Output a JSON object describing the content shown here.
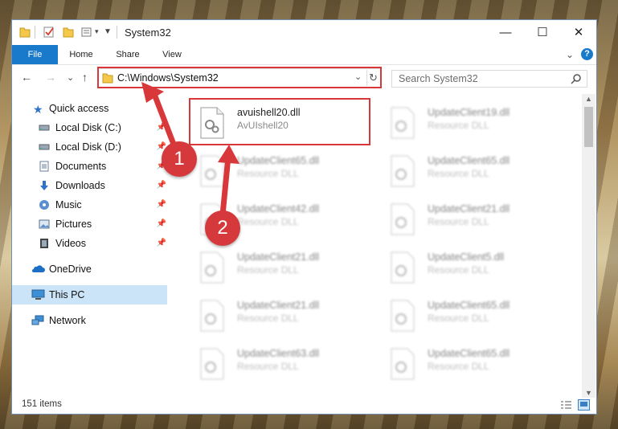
{
  "window": {
    "title": "System32",
    "controls": {
      "minimize": "—",
      "maximize": "☐",
      "close": "✕"
    }
  },
  "ribbon": {
    "tabs": [
      {
        "label": "File"
      },
      {
        "label": "Home"
      },
      {
        "label": "Share"
      },
      {
        "label": "View"
      }
    ],
    "help": "?",
    "expand": "⌄"
  },
  "navigation": {
    "back": "←",
    "forward": "→",
    "recent": "⌄",
    "up": "↑",
    "address": "C:\\Windows\\System32",
    "refresh": "↻",
    "search_placeholder": "Search System32"
  },
  "sidebar": {
    "items": [
      {
        "label": "Quick access",
        "icon": "star-icon"
      },
      {
        "label": "Local Disk (C:)",
        "icon": "drive-icon",
        "pinned": true
      },
      {
        "label": "Local Disk (D:)",
        "icon": "drive-icon",
        "pinned": true
      },
      {
        "label": "Documents",
        "icon": "documents-icon",
        "pinned": true
      },
      {
        "label": "Downloads",
        "icon": "downloads-icon",
        "pinned": true
      },
      {
        "label": "Music",
        "icon": "music-icon",
        "pinned": true
      },
      {
        "label": "Pictures",
        "icon": "pictures-icon",
        "pinned": true
      },
      {
        "label": "Videos",
        "icon": "videos-icon",
        "pinned": true
      },
      {
        "label": "OneDrive",
        "icon": "onedrive-icon"
      },
      {
        "label": "This PC",
        "icon": "pc-icon",
        "selected": true
      },
      {
        "label": "Network",
        "icon": "network-icon"
      }
    ]
  },
  "files": [
    {
      "name": "avuishell20.dll",
      "type": "AvUIshell20",
      "highlighted": true
    },
    {
      "name": "UpdateClient19.dll",
      "type": "Resource DLL"
    },
    {
      "name": "UpdateClient65.dll",
      "type": "Resource DLL"
    },
    {
      "name": "UpdateClient65.dll",
      "type": "Resource DLL"
    },
    {
      "name": "UpdateClient42.dll",
      "type": "Resource DLL"
    },
    {
      "name": "UpdateClient21.dll",
      "type": "Resource DLL"
    },
    {
      "name": "UpdateClient21.dll",
      "type": "Resource DLL"
    },
    {
      "name": "UpdateClient5.dll",
      "type": "Resource DLL"
    },
    {
      "name": "UpdateClient21.dll",
      "type": "Resource DLL"
    },
    {
      "name": "UpdateClient65.dll",
      "type": "Resource DLL"
    },
    {
      "name": "UpdateClient63.dll",
      "type": "Resource DLL"
    },
    {
      "name": "UpdateClient65.dll",
      "type": "Resource DLL"
    }
  ],
  "status": {
    "count": "151 items"
  },
  "annotations": {
    "badge1": "1",
    "badge2": "2"
  },
  "colors": {
    "accent": "#1979ca",
    "highlight": "#d9383a",
    "selected": "#cce4f7"
  }
}
